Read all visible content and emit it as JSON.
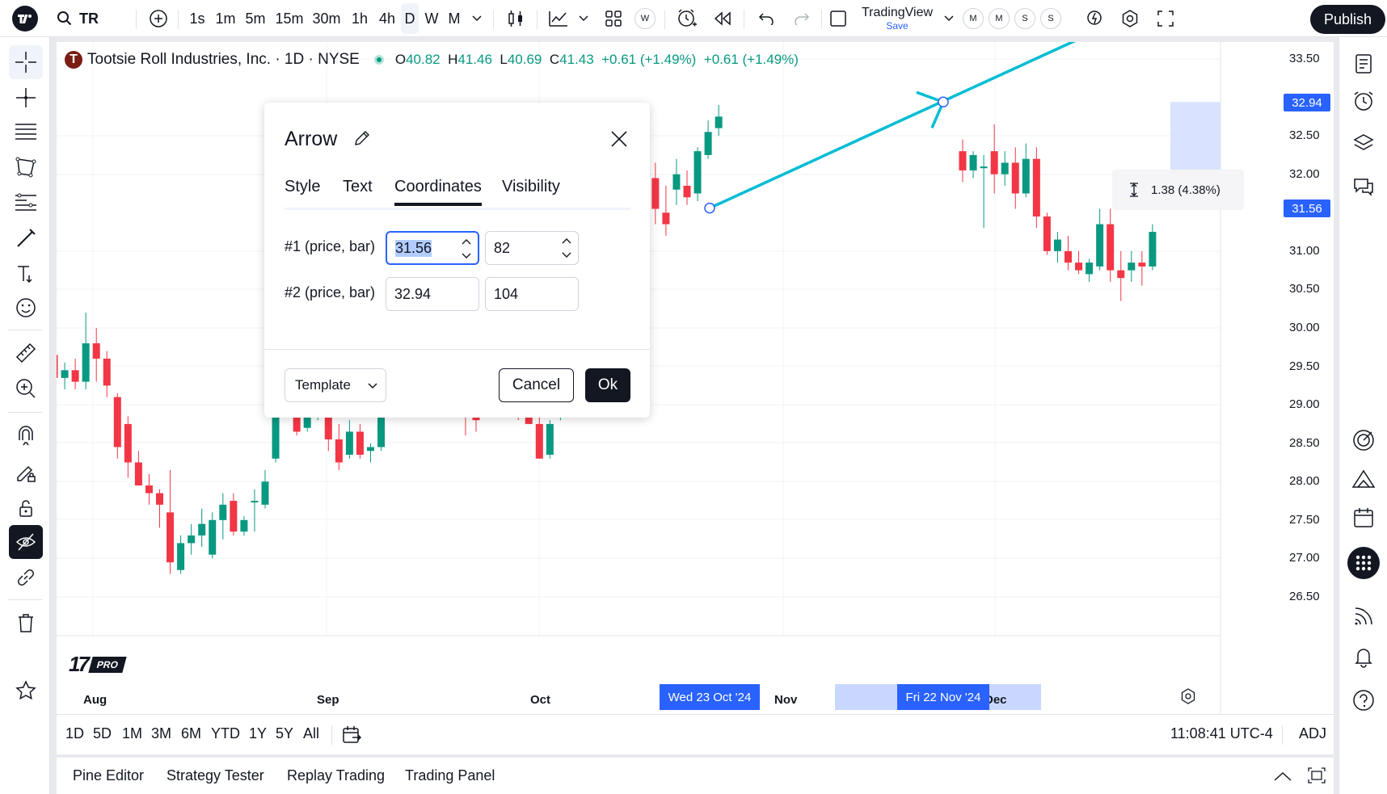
{
  "colors": {
    "up": "#089981",
    "down": "#f23645",
    "accent": "#2962ff",
    "drawing": "#00bcd4"
  },
  "topbar": {
    "symbol": "TR",
    "intervals": [
      "1s",
      "1m",
      "5m",
      "15m",
      "30m",
      "1h",
      "4h",
      "D",
      "W",
      "M"
    ],
    "selected_interval": "D",
    "layout_name": "TradingView",
    "save_label": "Save",
    "mini_tags": [
      "M",
      "M",
      "S",
      "S"
    ],
    "w_tag": "W",
    "publish_label": "Publish"
  },
  "legend": {
    "logo_letter": "T",
    "title": "Tootsie Roll Industries, Inc. · 1D · NYSE",
    "o_label": "O",
    "o": "40.82",
    "h_label": "H",
    "h": "41.46",
    "l_label": "L",
    "l": "40.69",
    "c_label": "C",
    "c": "41.43",
    "change": "+0.61 (+1.49%)",
    "change2": "+0.61 (+1.49%)"
  },
  "price_axis": [
    "33.50",
    "32.50",
    "32.00",
    "31.00",
    "30.50",
    "30.00",
    "29.50",
    "29.00",
    "28.50",
    "28.00",
    "27.50",
    "27.00",
    "26.50"
  ],
  "price_tags": {
    "upper": "32.94",
    "lower": "31.56"
  },
  "time_axis": [
    "Aug",
    "Sep",
    "Oct",
    "Nov",
    "Dec"
  ],
  "date_tags": {
    "start": "Wed 23 Oct '24",
    "end": "Fri 22 Nov '24"
  },
  "measure": {
    "text": "1.38 (4.38%)"
  },
  "watermark": {
    "logo": "17",
    "badge": "PRO"
  },
  "range_bar": {
    "ranges": [
      "1D",
      "5D",
      "1M",
      "3M",
      "6M",
      "YTD",
      "1Y",
      "5Y",
      "All"
    ],
    "clock": "11:08:41 UTC-4",
    "adj": "ADJ"
  },
  "bottom_tabs": [
    "Pine Editor",
    "Strategy Tester",
    "Replay Trading",
    "Trading Panel"
  ],
  "dialog": {
    "title": "Arrow",
    "tabs": [
      "Style",
      "Text",
      "Coordinates",
      "Visibility"
    ],
    "active_tab": "Coordinates",
    "point1": {
      "label": "#1 (price, bar)",
      "price": "31.56",
      "bar": "82"
    },
    "point2": {
      "label": "#2 (price, bar)",
      "price": "32.94",
      "bar": "104"
    },
    "template_label": "Template",
    "cancel_label": "Cancel",
    "ok_label": "Ok"
  },
  "chart_data": {
    "type": "candlestick",
    "ylim": [
      26.25,
      33.75
    ],
    "candles": [
      {
        "o": 29.65,
        "h": 29.85,
        "l": 29.35,
        "c": 29.35
      },
      {
        "o": 29.35,
        "h": 29.55,
        "l": 29.2,
        "c": 29.45
      },
      {
        "o": 29.45,
        "h": 29.6,
        "l": 29.2,
        "c": 29.3
      },
      {
        "o": 29.3,
        "h": 30.2,
        "l": 29.2,
        "c": 29.8
      },
      {
        "o": 29.8,
        "h": 30.0,
        "l": 29.3,
        "c": 29.6
      },
      {
        "o": 29.6,
        "h": 29.7,
        "l": 29.1,
        "c": 29.25
      },
      {
        "o": 29.1,
        "h": 29.15,
        "l": 28.3,
        "c": 28.45
      },
      {
        "o": 28.75,
        "h": 28.85,
        "l": 28.05,
        "c": 28.25
      },
      {
        "o": 28.25,
        "h": 28.4,
        "l": 27.95,
        "c": 27.95
      },
      {
        "o": 27.95,
        "h": 28.1,
        "l": 27.7,
        "c": 27.85
      },
      {
        "o": 27.85,
        "h": 27.9,
        "l": 27.4,
        "c": 27.7
      },
      {
        "o": 27.6,
        "h": 28.15,
        "l": 26.8,
        "c": 26.95
      },
      {
        "o": 26.85,
        "h": 27.3,
        "l": 26.8,
        "c": 27.2
      },
      {
        "o": 27.2,
        "h": 27.45,
        "l": 27.05,
        "c": 27.3
      },
      {
        "o": 27.3,
        "h": 27.65,
        "l": 27.15,
        "c": 27.45
      },
      {
        "o": 27.05,
        "h": 27.6,
        "l": 27.0,
        "c": 27.5
      },
      {
        "o": 27.5,
        "h": 27.85,
        "l": 27.25,
        "c": 27.7
      },
      {
        "o": 27.75,
        "h": 27.85,
        "l": 27.3,
        "c": 27.35
      },
      {
        "o": 27.35,
        "h": 27.55,
        "l": 27.3,
        "c": 27.5
      },
      {
        "o": 27.75,
        "h": 27.9,
        "l": 27.35,
        "c": 27.75
      },
      {
        "o": 27.7,
        "h": 28.15,
        "l": 27.65,
        "c": 28.0
      },
      {
        "o": 28.3,
        "h": 29.05,
        "l": 28.25,
        "c": 28.95
      },
      {
        "o": 29.1,
        "h": 29.35,
        "l": 29.0,
        "c": 29.3
      },
      {
        "o": 29.1,
        "h": 29.3,
        "l": 28.6,
        "c": 28.65
      },
      {
        "o": 28.7,
        "h": 29.2,
        "l": 28.65,
        "c": 28.85
      },
      {
        "o": 28.85,
        "h": 29.55,
        "l": 28.8,
        "c": 29.35
      },
      {
        "o": 29.3,
        "h": 29.4,
        "l": 28.4,
        "c": 28.55
      },
      {
        "o": 28.55,
        "h": 28.75,
        "l": 28.15,
        "c": 28.25
      },
      {
        "o": 28.35,
        "h": 28.8,
        "l": 28.3,
        "c": 28.65
      },
      {
        "o": 28.65,
        "h": 28.75,
        "l": 28.3,
        "c": 28.35
      },
      {
        "o": 28.4,
        "h": 28.5,
        "l": 28.25,
        "c": 28.45
      },
      {
        "o": 28.45,
        "h": 29.2,
        "l": 28.4,
        "c": 29.15
      },
      {
        "o": 29.0,
        "h": 29.35,
        "l": 28.95,
        "c": 29.15
      },
      {
        "o": 29.3,
        "h": 29.85,
        "l": 29.1,
        "c": 29.45
      },
      {
        "o": 29.45,
        "h": 29.6,
        "l": 29.05,
        "c": 29.3
      },
      {
        "o": 29.3,
        "h": 29.6,
        "l": 29.2,
        "c": 29.4
      },
      {
        "o": 29.35,
        "h": 29.5,
        "l": 29.2,
        "c": 29.4
      },
      {
        "o": 29.35,
        "h": 29.75,
        "l": 29.3,
        "c": 29.6
      },
      {
        "o": 29.4,
        "h": 29.55,
        "l": 28.95,
        "c": 29.0
      },
      {
        "o": 28.95,
        "h": 29.25,
        "l": 28.6,
        "c": 28.85
      },
      {
        "o": 28.85,
        "h": 29.1,
        "l": 28.65,
        "c": 28.8
      },
      {
        "o": 28.95,
        "h": 29.25,
        "l": 28.9,
        "c": 29.2
      },
      {
        "o": 29.15,
        "h": 29.5,
        "l": 29.05,
        "c": 29.3
      },
      {
        "o": 29.35,
        "h": 29.7,
        "l": 29.3,
        "c": 29.55
      },
      {
        "o": 29.3,
        "h": 29.45,
        "l": 28.8,
        "c": 28.85
      },
      {
        "o": 28.85,
        "h": 29.1,
        "l": 28.75,
        "c": 28.75
      },
      {
        "o": 28.75,
        "h": 28.85,
        "l": 28.3,
        "c": 28.3
      },
      {
        "o": 28.35,
        "h": 28.8,
        "l": 28.3,
        "c": 28.75
      },
      {
        "o": 28.85,
        "h": 29.1,
        "l": 28.8,
        "c": 29.05
      },
      {
        "o": 28.95,
        "h": 29.4,
        "l": 28.85,
        "c": 29.3
      },
      {
        "o": 29.5,
        "h": 29.85,
        "l": 29.45,
        "c": 29.7
      },
      {
        "o": 29.6,
        "h": 29.9,
        "l": 29.4,
        "c": 29.75
      },
      {
        "o": 29.75,
        "h": 30.05,
        "l": 29.7,
        "c": 29.9
      },
      {
        "o": 30.0,
        "h": 31.25,
        "l": 29.95,
        "c": 31.15
      },
      {
        "o": 31.05,
        "h": 31.75,
        "l": 30.5,
        "c": 31.65
      },
      {
        "o": 31.5,
        "h": 32.05,
        "l": 31.35,
        "c": 31.6
      },
      {
        "o": 31.7,
        "h": 32.3,
        "l": 31.6,
        "c": 31.95
      },
      {
        "o": 31.95,
        "h": 32.15,
        "l": 31.35,
        "c": 31.55
      },
      {
        "o": 31.5,
        "h": 31.85,
        "l": 31.2,
        "c": 31.35
      },
      {
        "o": 31.8,
        "h": 32.2,
        "l": 31.6,
        "c": 32.0
      },
      {
        "o": 31.85,
        "h": 32.05,
        "l": 31.6,
        "c": 31.7
      },
      {
        "o": 31.75,
        "h": 32.35,
        "l": 31.65,
        "c": 32.3
      },
      {
        "o": 32.25,
        "h": 32.7,
        "l": 32.2,
        "c": 32.55
      },
      {
        "o": 32.6,
        "h": 32.9,
        "l": 32.5,
        "c": 32.75
      }
    ],
    "candles_right": [
      {
        "o": 32.3,
        "h": 32.45,
        "l": 31.9,
        "c": 32.05
      },
      {
        "o": 32.05,
        "h": 32.3,
        "l": 31.95,
        "c": 32.25
      },
      {
        "o": 32.1,
        "h": 32.25,
        "l": 31.3,
        "c": 32.1
      },
      {
        "o": 32.3,
        "h": 32.65,
        "l": 31.75,
        "c": 32.0
      },
      {
        "o": 32.0,
        "h": 32.3,
        "l": 31.85,
        "c": 32.15
      },
      {
        "o": 32.15,
        "h": 32.35,
        "l": 31.55,
        "c": 31.75
      },
      {
        "o": 31.75,
        "h": 32.4,
        "l": 31.7,
        "c": 32.2
      },
      {
        "o": 32.2,
        "h": 32.35,
        "l": 31.3,
        "c": 31.45
      },
      {
        "o": 31.45,
        "h": 31.5,
        "l": 30.95,
        "c": 31.0
      },
      {
        "o": 31.0,
        "h": 31.25,
        "l": 30.85,
        "c": 31.15
      },
      {
        "o": 31.0,
        "h": 31.2,
        "l": 30.75,
        "c": 30.85
      },
      {
        "o": 30.85,
        "h": 31.0,
        "l": 30.7,
        "c": 30.75
      },
      {
        "o": 30.7,
        "h": 30.9,
        "l": 30.6,
        "c": 30.85
      },
      {
        "o": 30.8,
        "h": 31.55,
        "l": 30.75,
        "c": 31.35
      },
      {
        "o": 31.35,
        "h": 31.55,
        "l": 30.6,
        "c": 30.75
      },
      {
        "o": 30.75,
        "h": 31.0,
        "l": 30.35,
        "c": 30.65
      },
      {
        "o": 30.75,
        "h": 31.0,
        "l": 30.6,
        "c": 30.85
      },
      {
        "o": 30.85,
        "h": 31.0,
        "l": 30.55,
        "c": 30.8
      },
      {
        "o": 30.8,
        "h": 31.35,
        "l": 30.75,
        "c": 31.25
      }
    ],
    "arrow": {
      "p1": {
        "price": 31.56,
        "bar": 82
      },
      "p2": {
        "price": 32.94,
        "bar": 104
      }
    }
  }
}
